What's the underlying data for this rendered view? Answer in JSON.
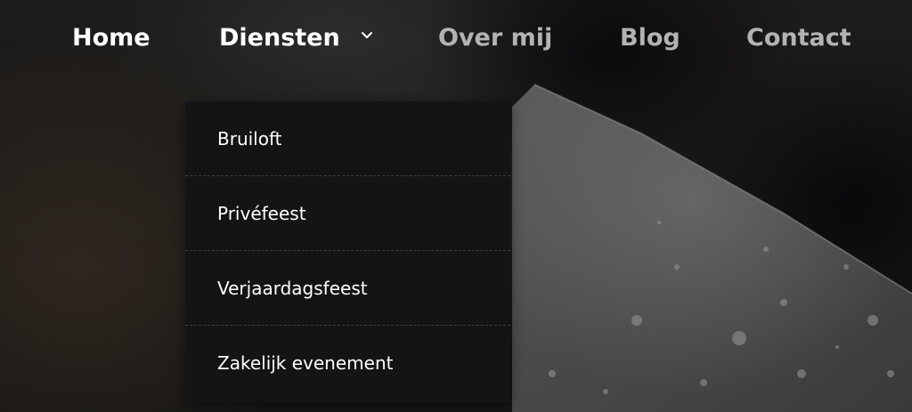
{
  "nav": {
    "items": [
      {
        "label": "Home",
        "state": "active"
      },
      {
        "label": "Diensten",
        "state": "open"
      },
      {
        "label": "Over mij",
        "state": "default"
      },
      {
        "label": "Blog",
        "state": "default"
      },
      {
        "label": "Contact",
        "state": "default"
      }
    ],
    "dropdown_icon": "chevron-down-icon"
  },
  "dropdown": {
    "items": [
      {
        "label": "Bruiloft"
      },
      {
        "label": "Privéfeest"
      },
      {
        "label": "Verjaardagsfeest"
      },
      {
        "label": "Zakelijk evenement"
      }
    ]
  },
  "colors": {
    "nav_active": "#ffffff",
    "nav_muted": "#b3b3b3",
    "dropdown_bg": "#121416",
    "dropdown_text": "#ffffff"
  },
  "background": {
    "image_subject": "dark photo of a wet knife blade and charcoal"
  }
}
